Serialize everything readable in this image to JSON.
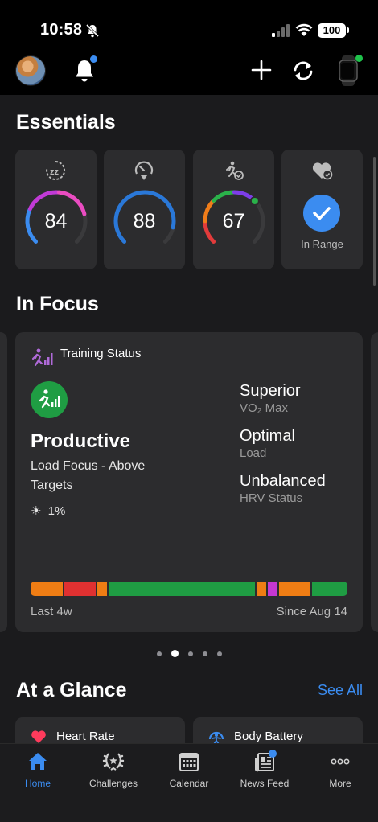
{
  "status_bar": {
    "time": "10:58",
    "battery": "100"
  },
  "essentials": {
    "title": "Essentials",
    "cards": [
      {
        "icon": "sleep-score-icon",
        "value": "84",
        "ring_fill": 0.78,
        "ring_colors": [
          "#3b8cf0",
          "#c13ad6",
          "#ea4cc1"
        ]
      },
      {
        "icon": "stress-gauge-icon",
        "value": "88",
        "ring_fill": 0.88,
        "ring_colors": [
          "#2a78d8",
          "#2a78d8"
        ]
      },
      {
        "icon": "readiness-icon",
        "value": "67",
        "ring_fill": 0.67,
        "ring_colors": [
          "#e23b3b",
          "#f07d1a",
          "#2ab24a",
          "#7d3ee8"
        ]
      },
      {
        "icon": "heart-check-icon",
        "label": "In Range"
      }
    ]
  },
  "in_focus": {
    "title": "In Focus",
    "card": {
      "title": "Training Status",
      "status": "Productive",
      "description": "Load Focus - Above Targets",
      "heat_value": "1%",
      "metrics": [
        {
          "value": "Superior",
          "label": "VO₂ Max"
        },
        {
          "value": "Optimal",
          "label": "Load"
        },
        {
          "value": "Unbalanced",
          "label": "HRV Status"
        }
      ],
      "timeline": [
        {
          "color": "#ef7d14",
          "weight": 10
        },
        {
          "color": "#e03131",
          "weight": 10
        },
        {
          "color": "#ef7d14",
          "weight": 3
        },
        {
          "color": "#1f9d43",
          "weight": 46
        },
        {
          "color": "#ef7d14",
          "weight": 3
        },
        {
          "color": "#c537d1",
          "weight": 3
        },
        {
          "color": "#ef7d14",
          "weight": 10
        },
        {
          "color": "#1f9d43",
          "weight": 11
        }
      ],
      "timeline_left": "Last 4w",
      "timeline_right": "Since Aug 14"
    },
    "pages": 5,
    "active_page": 1
  },
  "at_a_glance": {
    "title": "At a Glance",
    "see_all": "See All",
    "cards": [
      {
        "icon": "heart-icon",
        "label": "Heart Rate"
      },
      {
        "icon": "body-battery-icon",
        "label": "Body Battery"
      }
    ]
  },
  "bottom_nav": [
    {
      "icon": "home-icon",
      "label": "Home",
      "active": true
    },
    {
      "icon": "challenges-laurel-icon",
      "label": "Challenges"
    },
    {
      "icon": "calendar-icon",
      "label": "Calendar"
    },
    {
      "icon": "news-feed-icon",
      "label": "News Feed",
      "badge": true
    },
    {
      "icon": "more-icon",
      "label": "More"
    }
  ]
}
